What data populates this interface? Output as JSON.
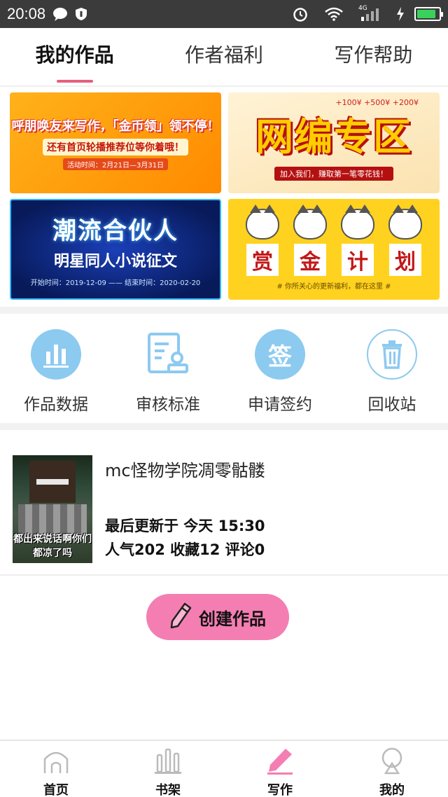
{
  "status_bar": {
    "time": "20:08",
    "network": "4G"
  },
  "tabs": [
    {
      "label": "我的作品",
      "active": true
    },
    {
      "label": "作者福利",
      "active": false
    },
    {
      "label": "写作帮助",
      "active": false
    }
  ],
  "banners": {
    "b1": {
      "line1": "呼朋唤友来写作，「金币领」领不停！",
      "line2": "还有首页轮播推荐位等你着哦！",
      "line3": "活动时间：2月21日—3月31日"
    },
    "b2": {
      "title": "网编专区",
      "subtitle": "加入我们，赚取第一笔零花钱！",
      "note": "+100¥  +500¥  +200¥"
    },
    "b3": {
      "title": "潮流合伙人",
      "subtitle": "明星同人小说征文",
      "dates": "开始时间：2019-12-09 —— 结束时间：2020-02-20"
    },
    "b4": {
      "chars": [
        "赏",
        "金",
        "计",
        "划"
      ],
      "caption": "# 你所关心的更新福利，都在这里 #"
    }
  },
  "quick_actions": [
    {
      "label": "作品数据",
      "icon": "bar-chart-icon"
    },
    {
      "label": "审核标准",
      "icon": "document-stamp-icon"
    },
    {
      "label": "申请签约",
      "icon": "sign-icon",
      "icon_text": "签"
    },
    {
      "label": "回收站",
      "icon": "trash-icon"
    }
  ],
  "work": {
    "title": "mc怪物学院凋零骷髅",
    "updated": "最后更新于 今天 15:30",
    "stats": "人气202 收藏12 评论0",
    "cover_text": "都出来说话啊你们都凉了吗"
  },
  "create_button": {
    "label": "创建作品"
  },
  "bottom_nav": [
    {
      "label": "首页",
      "icon": "home-icon"
    },
    {
      "label": "书架",
      "icon": "bookshelf-icon"
    },
    {
      "label": "写作",
      "icon": "pen-icon",
      "active": true
    },
    {
      "label": "我的",
      "icon": "profile-icon"
    }
  ],
  "colors": {
    "accent": "#e75f7e",
    "icon_blue": "#8ccaf0",
    "button_pink": "#f47eb2"
  }
}
